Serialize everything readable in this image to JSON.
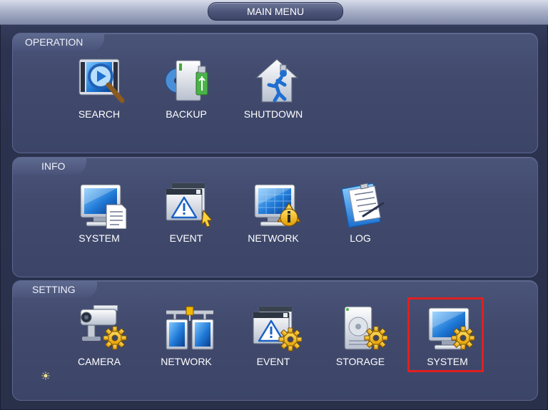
{
  "title": "MAIN MENU",
  "sections": {
    "operation": {
      "label": "OPERATION",
      "items": [
        {
          "label": "SEARCH",
          "icon": "search-icon"
        },
        {
          "label": "BACKUP",
          "icon": "backup-icon"
        },
        {
          "label": "SHUTDOWN",
          "icon": "shutdown-icon"
        }
      ]
    },
    "info": {
      "label": "INFO",
      "items": [
        {
          "label": "SYSTEM",
          "icon": "system-info-icon"
        },
        {
          "label": "EVENT",
          "icon": "event-info-icon"
        },
        {
          "label": "NETWORK",
          "icon": "network-info-icon"
        },
        {
          "label": "LOG",
          "icon": "log-icon"
        }
      ]
    },
    "setting": {
      "label": "SETTING",
      "items": [
        {
          "label": "CAMERA",
          "icon": "camera-setting-icon"
        },
        {
          "label": "NETWORK",
          "icon": "network-setting-icon"
        },
        {
          "label": "EVENT",
          "icon": "event-setting-icon"
        },
        {
          "label": "STORAGE",
          "icon": "storage-setting-icon"
        },
        {
          "label": "SYSTEM",
          "icon": "system-setting-icon"
        }
      ]
    }
  },
  "selected": "setting.system",
  "colors": {
    "highlight": "#e02020",
    "accent": "#2f8de0",
    "gear": "#f0b800"
  }
}
